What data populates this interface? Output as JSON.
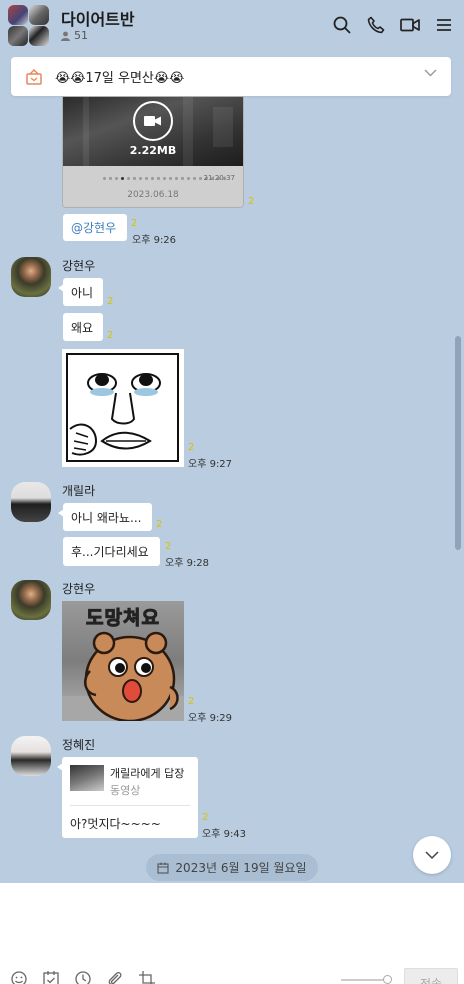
{
  "header": {
    "title": "다이어트반",
    "member_count": "51"
  },
  "notice": {
    "text": "😭😭17일 우면산😭😭"
  },
  "video": {
    "size": "2.22MB",
    "timestamp": "21:20:37",
    "date": "2023.06.18"
  },
  "messages": {
    "m1_unread": "2",
    "m2_text": "@강현우",
    "m2_unread": "2",
    "m2_time": "오후 9:26",
    "sender1": "강현우",
    "m3_text": "아니",
    "m3_unread": "2",
    "m4_text": "왜요",
    "m4_unread": "2",
    "m5_unread": "2",
    "m5_time": "오후 9:27",
    "sender2": "개릴라",
    "m6_text": "아니 왜라뇨...",
    "m6_unread": "2",
    "m7_text": "후...기다리세요",
    "m7_unread": "2",
    "m7_time": "오후 9:28",
    "sender3": "강현우",
    "m8_emoticon_text": "도망쳐요",
    "m8_unread": "2",
    "m8_time": "오후 9:29",
    "sender4": "정혜진",
    "m9_reply_title": "개릴라에게 답장",
    "m9_reply_sub": "동영상",
    "m9_text": "아?멋지다~~~~",
    "m9_unread": "2",
    "m9_time": "오후 9:43"
  },
  "date_divider": "2023년 6월 19일 월요일",
  "input": {
    "send_label": "전송"
  },
  "colors": {
    "background": "#b9cce0",
    "unread": "#d8c200",
    "mention": "#3a7fc2"
  }
}
